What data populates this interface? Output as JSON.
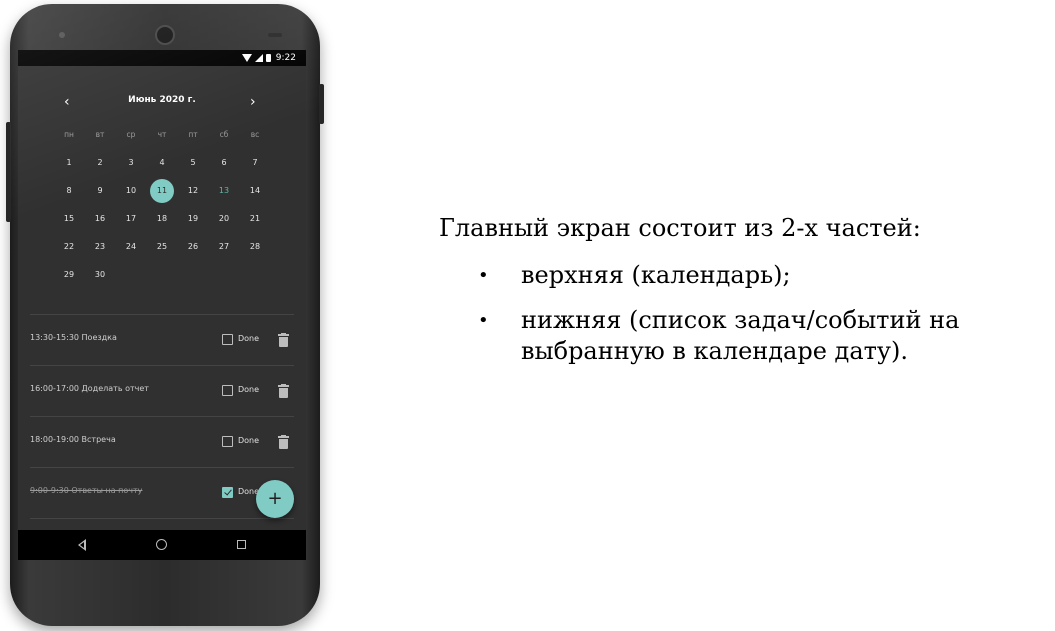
{
  "status_bar": {
    "time": "9:22"
  },
  "calendar": {
    "title": "Июнь 2020 г.",
    "prev_icon": "chevron-left-icon",
    "next_icon": "chevron-right-icon",
    "prev_glyph": "‹",
    "next_glyph": "›",
    "weekdays": [
      "пн",
      "вт",
      "ср",
      "чт",
      "пт",
      "сб",
      "вс"
    ],
    "days": [
      "1",
      "2",
      "3",
      "4",
      "5",
      "6",
      "7",
      "8",
      "9",
      "10",
      "11",
      "12",
      "13",
      "14",
      "15",
      "16",
      "17",
      "18",
      "19",
      "20",
      "21",
      "22",
      "23",
      "24",
      "25",
      "26",
      "27",
      "28",
      "29",
      "30"
    ],
    "selected_day": "11",
    "today_day": "13",
    "accent_color": "#80cbc4"
  },
  "tasks": [
    {
      "text": "13:30-15:30 Поездка",
      "done": false,
      "done_label": "Done"
    },
    {
      "text": "16:00-17:00 Доделать отчет",
      "done": false,
      "done_label": "Done"
    },
    {
      "text": "18:00-19:00 Встреча",
      "done": false,
      "done_label": "Done"
    },
    {
      "text": "9:00-9:30 Ответы на почту",
      "done": true,
      "done_label": "Done"
    }
  ],
  "fab": {
    "icon": "plus-icon",
    "glyph": "+"
  },
  "nav_bar": {
    "back_icon": "back-icon",
    "home_icon": "home-icon",
    "recents_icon": "recents-icon"
  },
  "slide": {
    "heading": "Главный экран состоит из 2-х частей:",
    "bullets": [
      "верхняя (календарь);",
      "нижняя (список задач/событий на выбранную в календаре дату)."
    ]
  }
}
